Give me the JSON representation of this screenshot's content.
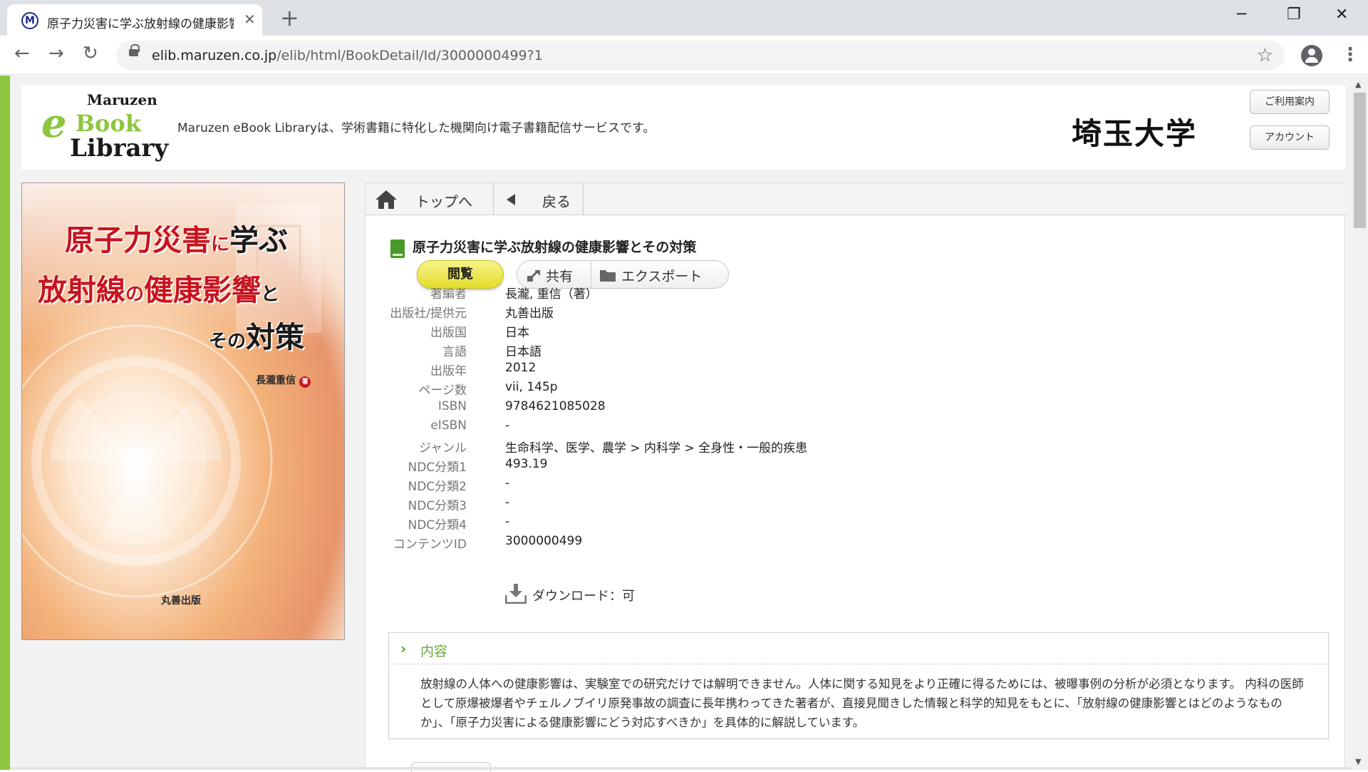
{
  "browser": {
    "tab_title": "原子力災害に学ぶ放射線の健康影響とその対策",
    "tab_favicon": "M",
    "new_tab": "+",
    "url_domain": "elib.maruzen.co.jp",
    "url_path": "/elib/html/BookDetail/Id/3000000499?1",
    "back": "←",
    "forward": "→",
    "reload": "↻",
    "bookmark_star": "☆",
    "menu": "⋮",
    "minimize": "─",
    "restore": "❐",
    "close": "✕",
    "tab_close": "✕"
  },
  "header": {
    "logo": {
      "line1": "Maruzen",
      "e": "e",
      "line2": "Book",
      "line3": "Library"
    },
    "tagline": "Maruzen eBook Libraryは、学術書籍に特化した機関向け電子書籍配信サービスです。",
    "institution": "埼玉大学",
    "guide_button": "ご利用案内",
    "account_button": "アカウント"
  },
  "cover": {
    "title_line1a": "原子力災害",
    "title_line1b": "に",
    "title_line1c": "学ぶ",
    "title_line2a": "放射線",
    "title_line2b": "の",
    "title_line2c": "健康影響",
    "title_line2d": "と",
    "title_line3a": "その",
    "title_line3b": "対策",
    "author": "長瀧重信",
    "author_suffix": "著",
    "publisher": "丸善出版"
  },
  "nav": {
    "top_label": "トップへ",
    "back_label": "戻る"
  },
  "book": {
    "title": "原子力災害に学ぶ放射線の健康影響とその対策",
    "read_button": "閲覧",
    "share_button": "共有",
    "export_button": "エクスポート",
    "metadata": [
      {
        "label": "著編者",
        "value": "長瀧, 重信（著）"
      },
      {
        "label": "出版社/提供元",
        "value": "丸善出版"
      },
      {
        "label": "出版国",
        "value": "日本"
      },
      {
        "label": "言語",
        "value": "日本語"
      },
      {
        "label": "出版年",
        "value": "2012"
      },
      {
        "label": "ページ数",
        "value": "vii, 145p"
      },
      {
        "label": "ISBN",
        "value": "9784621085028"
      },
      {
        "label": "eISBN",
        "value": "-"
      },
      {
        "label": "ジャンル",
        "value": "生命科学、医学、農学 > 内科学 > 全身性・一般的疾患"
      },
      {
        "label": "NDC分類1",
        "value": "493.19"
      },
      {
        "label": "NDC分類2",
        "value": "-"
      },
      {
        "label": "NDC分類3",
        "value": "-"
      },
      {
        "label": "NDC分類4",
        "value": "-"
      },
      {
        "label": "コンテンツID",
        "value": "3000000499"
      }
    ],
    "download": "ダウンロード：可"
  },
  "content_section": {
    "title": "内容",
    "chevron": "›",
    "text": "放射線の人体への健康影響は、実験室での研究だけでは解明できません。人体に関する知見をより正確に得るためには、被曝事例の分析が必須となります。 内科の医師として原爆被爆者やチェルノブイリ原発事故の調査に長年携わってきた著者が、直接見聞きした情報と科学的知見をもとに、「放射線の健康影響とはどのようなものか」、「原子力災害による健康影響にどう対応すべきか」を具体的に解説しています。"
  },
  "colors": {
    "accent_green": "#8cc63f",
    "read_button_yellow": "#e8e23a",
    "cover_title_red": "#c8141e"
  }
}
